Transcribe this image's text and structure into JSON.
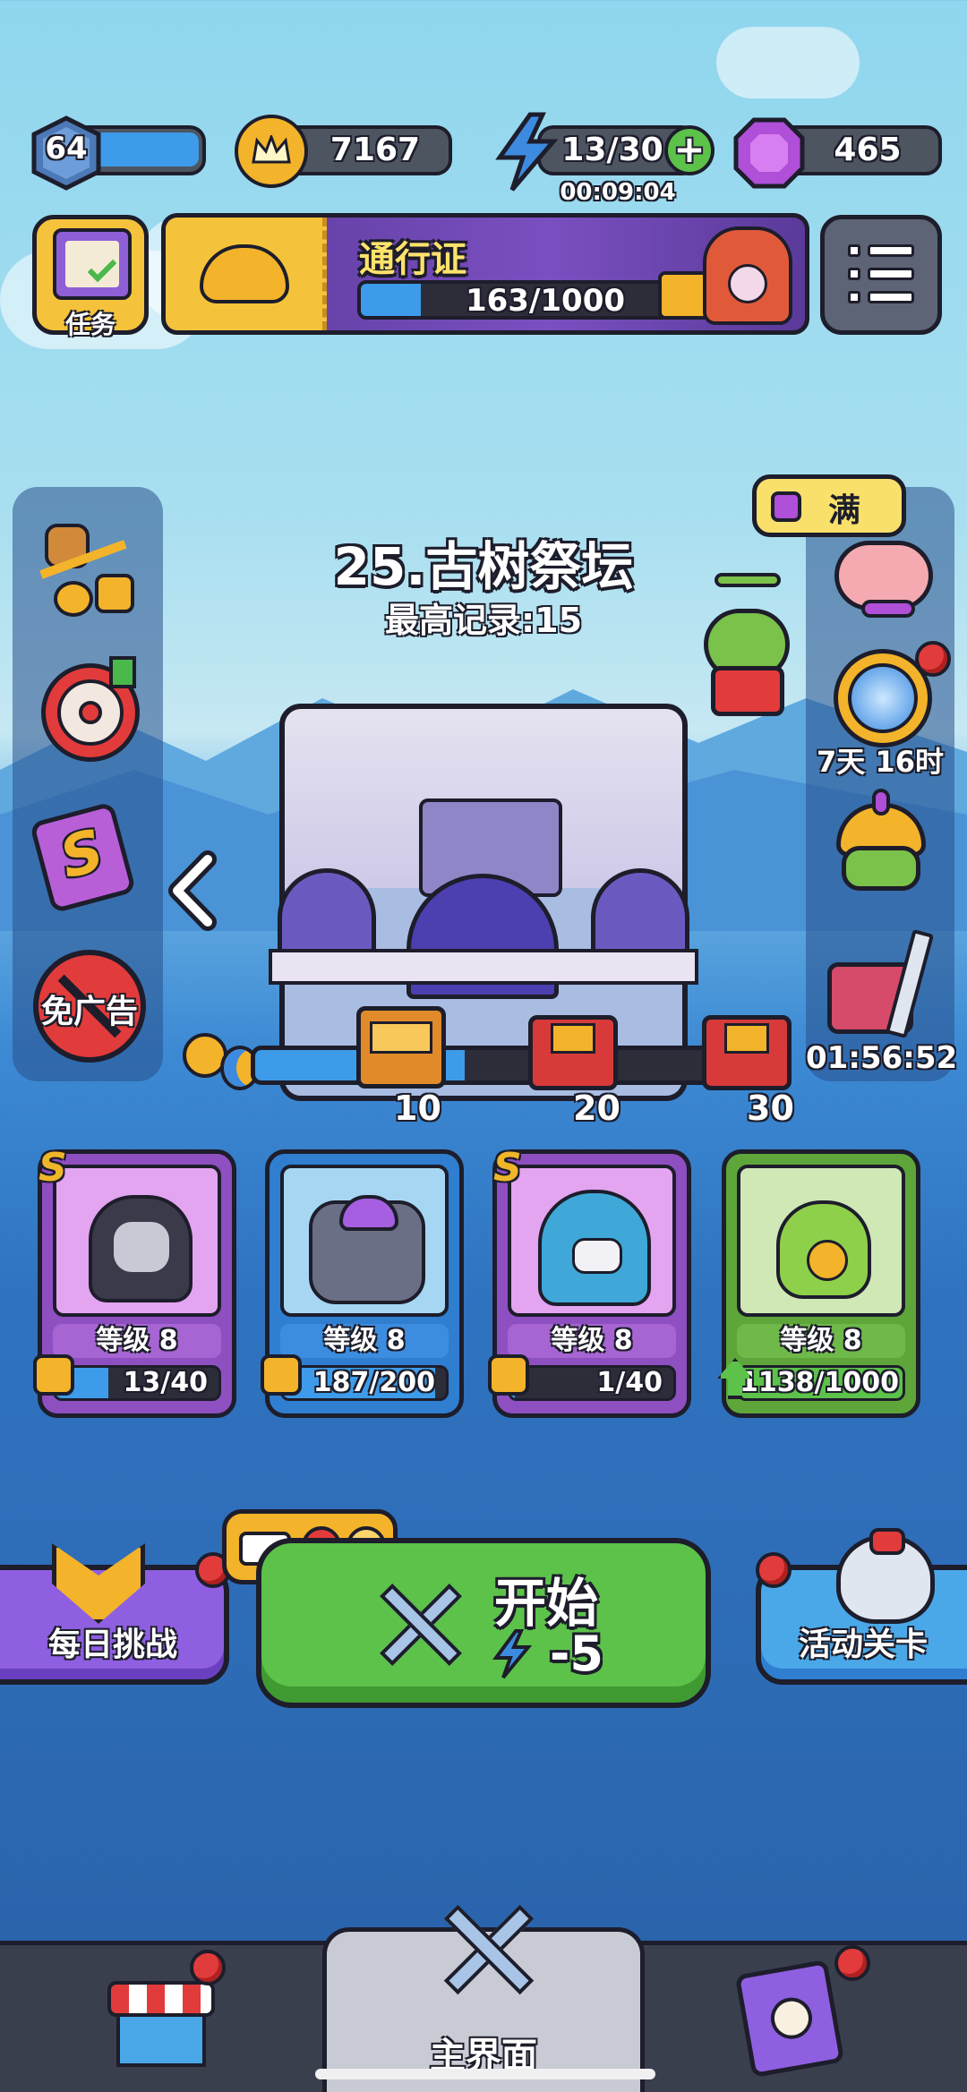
{
  "top_bar": {
    "level": "64",
    "coins": "7167",
    "energy": "13/30",
    "energy_timer": "00:09:04",
    "gems": "465",
    "plus_icon": "plus-icon"
  },
  "quest_button": {
    "label": "任务"
  },
  "battle_pass": {
    "title": "通行证",
    "progress_text": "163/1000",
    "progress": 0.163
  },
  "stage": {
    "name": "25.古树祭坛",
    "best_record": "最高记录:15"
  },
  "piggy_bank": {
    "label": "满"
  },
  "left_menu": [
    {
      "name": "growth-fund-icon"
    },
    {
      "name": "speed-target-icon"
    },
    {
      "name": "s-card-icon"
    },
    {
      "name": "no-ads-icon",
      "label": "免广告"
    }
  ],
  "right_menu": [
    {
      "name": "piggy-bank-icon"
    },
    {
      "name": "wheel-icon",
      "label": "7天 16时"
    },
    {
      "name": "turban-pet-icon"
    },
    {
      "name": "sword-chest-icon",
      "label": "01:56:52"
    }
  ],
  "day_progress": {
    "progress": 0.45,
    "milestones": [
      "10",
      "20",
      "30"
    ]
  },
  "heroes": [
    {
      "level": "等级 8",
      "progress_text": "13/40",
      "progress": 0.325,
      "rarity": "S",
      "color": "#b85fd8"
    },
    {
      "level": "等级 8",
      "progress_text": "187/200",
      "progress": 0.935,
      "rarity": "",
      "color": "#4aa8e8"
    },
    {
      "level": "等级 8",
      "progress_text": "1/40",
      "progress": 0.025,
      "rarity": "S",
      "color": "#b85fd8"
    },
    {
      "level": "等级 8",
      "progress_text": "1138/1000",
      "progress": 1.0,
      "rarity": "",
      "color": "#7ac24a"
    }
  ],
  "daily_challenge": {
    "label": "每日挑战"
  },
  "start_button": {
    "label": "开始",
    "cost": "-5"
  },
  "event_stage": {
    "label": "活动关卡"
  },
  "bottom_nav": {
    "main_label": "主界面"
  }
}
